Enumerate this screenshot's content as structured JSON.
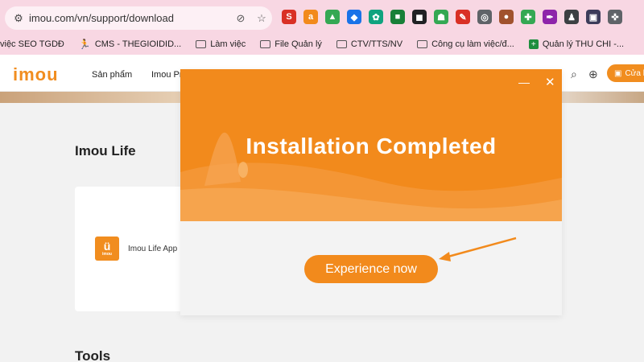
{
  "browser": {
    "url": "imou.com/vn/support/download",
    "extensions": [
      {
        "icon": "s-red-icon",
        "glyph": "S",
        "color": "#d93025"
      },
      {
        "icon": "amazon-icon",
        "glyph": "a",
        "color": "#f28a1c"
      },
      {
        "icon": "drive-icon",
        "glyph": "▲",
        "color": "#34a853"
      },
      {
        "icon": "tag-icon",
        "glyph": "◆",
        "color": "#1a73e8"
      },
      {
        "icon": "openai-icon",
        "glyph": "✿",
        "color": "#10a37f"
      },
      {
        "icon": "green-square-icon",
        "glyph": "■",
        "color": "#188038"
      },
      {
        "icon": "black-square-icon",
        "glyph": "◼",
        "color": "#202124"
      },
      {
        "icon": "android-badge-icon",
        "glyph": "☗",
        "color": "#34a853"
      },
      {
        "icon": "pdf-icon",
        "glyph": "✎",
        "color": "#d93025"
      },
      {
        "icon": "compass-icon",
        "glyph": "◎",
        "color": "#5f6368"
      },
      {
        "icon": "cookie-icon",
        "glyph": "●",
        "color": "#a0522d"
      },
      {
        "icon": "sparkle-icon",
        "glyph": "✚",
        "color": "#34a853"
      },
      {
        "icon": "pen-icon",
        "glyph": "✒",
        "color": "#8e24aa"
      },
      {
        "icon": "spy-icon",
        "glyph": "♟",
        "color": "#3c4043"
      },
      {
        "icon": "dark-box-icon",
        "glyph": "▣",
        "color": "#3c3c5a"
      },
      {
        "icon": "puzzle-icon",
        "glyph": "✜",
        "color": "#5f6368"
      }
    ]
  },
  "bookmarks": [
    {
      "label": "việc SEO TGDĐ",
      "icon": "none"
    },
    {
      "label": "CMS - THEGIOIDID...",
      "icon": "runner-icon"
    },
    {
      "label": "Làm việc",
      "icon": "folder-icon"
    },
    {
      "label": "File Quản lý",
      "icon": "folder-icon"
    },
    {
      "label": "CTV/TTS/NV",
      "icon": "folder-icon"
    },
    {
      "label": "Công cụ làm việc/đ...",
      "icon": "folder-icon"
    },
    {
      "label": "Quản lý THU CHI -...",
      "icon": "sheets-icon"
    }
  ],
  "site": {
    "logo": "imou",
    "nav": [
      "Sản phẩm",
      "Imou Pr"
    ],
    "store_label": "Cửa h"
  },
  "page": {
    "section1": "Imou Life",
    "app_name": "Imou Life App",
    "app_logo_small": "imou",
    "section2": "Tools"
  },
  "dialog": {
    "title": "Installation Completed",
    "button": "Experience now",
    "minimize": "—",
    "close": "✕"
  },
  "colors": {
    "accent": "#f28a1c",
    "browser_bar": "#f8d7e3"
  }
}
